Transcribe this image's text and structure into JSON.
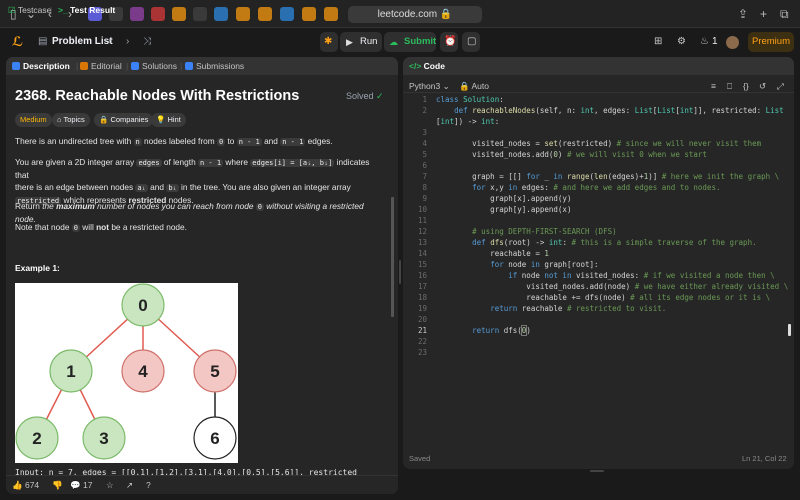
{
  "browser": {
    "url": "leetcode.com"
  },
  "header": {
    "problem_list": "Problem List",
    "run": "Run",
    "submit": "Submit",
    "streak": "1",
    "premium": "Premium"
  },
  "left_tabs": [
    "Description",
    "Editorial",
    "Solutions",
    "Submissions"
  ],
  "problem": {
    "title": "2368. Reachable Nodes With Restrictions",
    "solved": "Solved",
    "difficulty": "Medium",
    "chips": [
      "Topics",
      "Companies",
      "Hint"
    ],
    "p1_a": "There is an undirected tree with ",
    "p1_n": "n",
    "p1_b": " nodes labeled from ",
    "p1_0": "0",
    "p1_c": " to ",
    "p1_n1": "n - 1",
    "p1_d": " and ",
    "p1_n2": "n - 1",
    "p1_e": " edges.",
    "p2_a": "You are given a 2D integer array ",
    "p2_edges": "edges",
    "p2_b": " of length ",
    "p2_n1": "n - 1",
    "p2_c": " where ",
    "p2_code": "edges[i] = [aᵢ, bᵢ]",
    "p2_d": " indicates that",
    "p2_e": "there is an edge between nodes ",
    "p2_ai": "aᵢ",
    "p2_f": " and ",
    "p2_bi": "bᵢ",
    "p2_g": " in the tree. You are also given an integer array",
    "p2_restricted": "restricted",
    "p2_h": " which represents ",
    "p2_restricted_bold": "restricted",
    "p2_i": " nodes.",
    "p3_a": "Return ",
    "p3_the": "the ",
    "p3_max": "maximum",
    "p3_b": " number of nodes you can reach from node ",
    "p3_0": "0",
    "p3_c": " without visiting a restricted node.",
    "p4_a": "Note that node ",
    "p4_0": "0",
    "p4_b": " will ",
    "p4_not": "not",
    "p4_c": " be a restricted node.",
    "example": "Example 1:",
    "cut_line": "Input: n = 7, edges = [[0,1],[1,2],[3,1],[4,0],[0,5],[5,6]], restricted"
  },
  "tree": {
    "nodes": [
      {
        "label": "0",
        "color": "#c9e6c0"
      },
      {
        "label": "1",
        "color": "#c9e6c0"
      },
      {
        "label": "4",
        "color": "#f3c7c4"
      },
      {
        "label": "5",
        "color": "#f3c7c4"
      },
      {
        "label": "2",
        "color": "#c9e6c0"
      },
      {
        "label": "3",
        "color": "#c9e6c0"
      },
      {
        "label": "6",
        "color": "#ffffff"
      }
    ]
  },
  "footer": {
    "likes": "674",
    "comments": "17"
  },
  "code": {
    "tab": "Code",
    "language": "Python3",
    "mode": "Auto",
    "saved": "Saved",
    "position": "Ln 21, Col 22",
    "lines": [
      "1",
      "2",
      "",
      "3",
      "4",
      "5",
      "6",
      "7",
      "8",
      "9",
      "10",
      "11",
      "12",
      "13",
      "14",
      "15",
      "16",
      "17",
      "18",
      "19",
      "20",
      "21",
      "22",
      "23"
    ]
  },
  "bottom": {
    "testcase": "Testcase",
    "result": "Test Result"
  },
  "colors": {
    "accent": "#ffa116",
    "submit_green": "#2cbb5d",
    "medium": "#ffb800"
  }
}
